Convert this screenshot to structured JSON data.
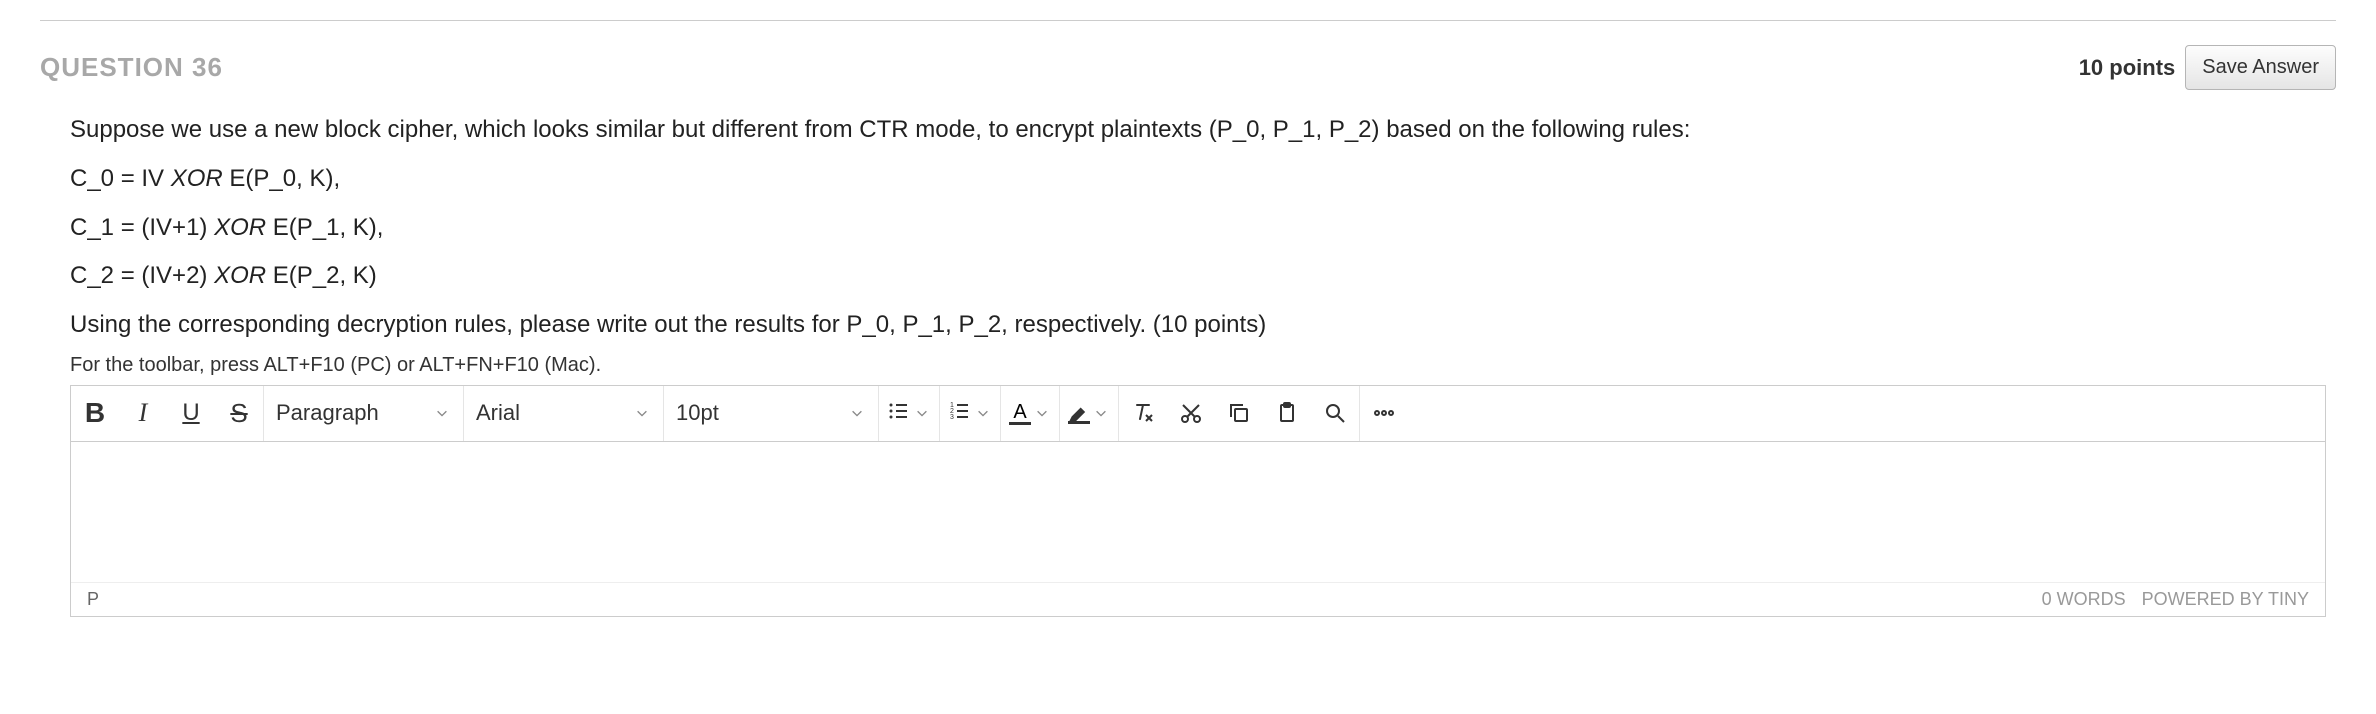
{
  "header": {
    "question_label": "QUESTION 36",
    "points": "10 points",
    "save_label": "Save Answer"
  },
  "question": {
    "line1_pre": "Suppose we use a new block cipher, which looks similar but different from CTR mode, to encrypt plaintexts (P_0, P_1, P_2) based on the following rules:",
    "line2_a": "C_0 = IV ",
    "line2_xor": "XOR",
    "line2_b": " E(P_0, K),",
    "line3_a": "C_1 = (IV+1) ",
    "line3_xor": "XOR",
    "line3_b": " E(P_1, K),",
    "line4_a": "C_2 = (IV+2) ",
    "line4_xor": "XOR",
    "line4_b": " E(P_2, K)",
    "line5": "Using the corresponding decryption rules, please write out the results for P_0, P_1, P_2, respectively. (10 points)",
    "toolbar_hint": "For the toolbar, press ALT+F10 (PC) or ALT+FN+F10 (Mac)."
  },
  "toolbar": {
    "bold": "B",
    "italic": "I",
    "underline": "U",
    "strike": "S",
    "block_format": "Paragraph",
    "font_family": "Arial",
    "font_size": "10pt",
    "font_color_letter": "A"
  },
  "footer": {
    "path": "P",
    "words": "0 WORDS",
    "powered": "POWERED BY TINY"
  }
}
